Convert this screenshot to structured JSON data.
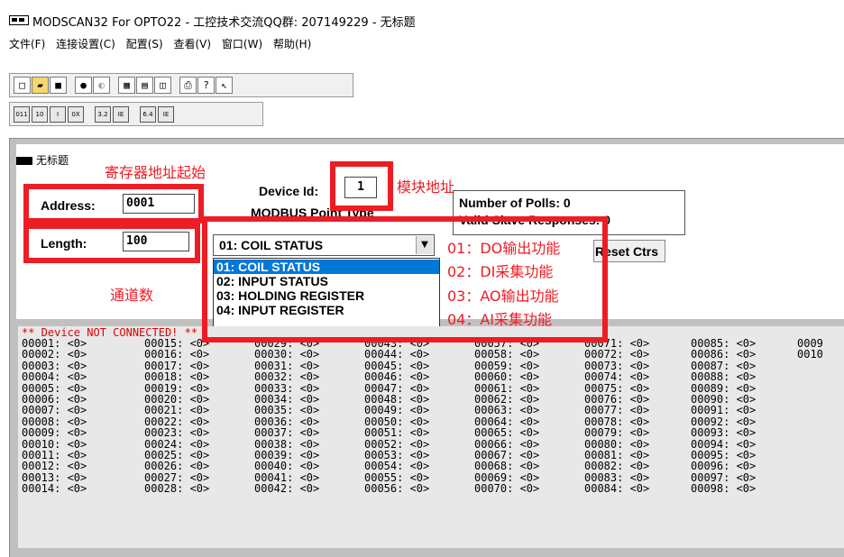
{
  "window": {
    "title": "MODSCAN32 For OPTO22 - 工控技术交流QQ群: 207149229 - 无标题"
  },
  "menu": [
    "文件(F)",
    "连接设置(C)",
    "配置(S)",
    "查看(V)",
    "窗口(W)",
    "帮助(H)"
  ],
  "child": {
    "title": "无标题"
  },
  "form": {
    "address_label": "Address:",
    "address_value": "0001",
    "length_label": "Length:",
    "length_value": "100",
    "device_id_label": "Device Id:",
    "device_id_value": "1",
    "point_type_label": "MODBUS Point Type",
    "polls_label": "Number of Polls: 0",
    "valid_label": "Valid Slave Responses: 0",
    "reset_label": "Reset Ctrs"
  },
  "point_type": {
    "selected": "01: COIL STATUS",
    "options": [
      "01: COIL STATUS",
      "02: INPUT STATUS",
      "03: HOLDING REGISTER",
      "04: INPUT REGISTER"
    ]
  },
  "annotations": {
    "address_start": "寄存器地址起始",
    "module_address": "模块地址",
    "channel_count": "通道数",
    "func": [
      "01：DO输出功能",
      "02：DI采集功能",
      "03：AO输出功能",
      "04：AI采集功能"
    ]
  },
  "console": {
    "status": "** Device NOT CONNECTED! **",
    "value": "<0>",
    "visible_rows": 14,
    "first_address": 1,
    "column_step": 14,
    "columns_partial_last": "0009|0010"
  },
  "colors": {
    "annotation": "#ee1c24",
    "selection": "#0078d7",
    "status_text": "#e00000"
  }
}
